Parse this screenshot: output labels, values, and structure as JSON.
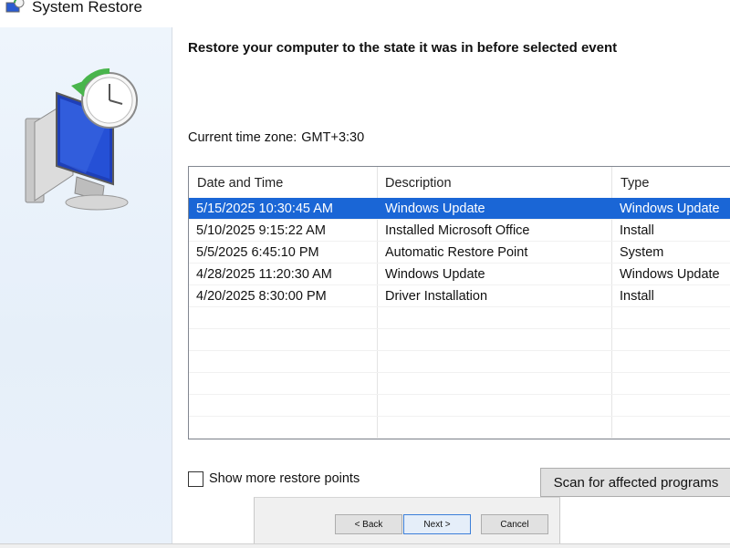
{
  "window": {
    "title": "System Restore",
    "icon": "system-restore-icon"
  },
  "sidebar": {
    "icon": "restore-clock-monitor-icon"
  },
  "main": {
    "heading": "Restore your computer to the state it was in before selected event",
    "timezone_label": "Current time zone:",
    "timezone_value": "GMT+3:30"
  },
  "table": {
    "columns": [
      "Date and Time",
      "Description",
      "Type"
    ],
    "rows": [
      {
        "date": "5/15/2025  10:30:45 AM",
        "description": "Windows Update",
        "type": "Windows Update",
        "selected": true
      },
      {
        "date": "5/10/2025  9:15:22 AM",
        "description": "Installed Microsoft Office",
        "type": "Install",
        "selected": false
      },
      {
        "date": "5/5/2025  6:45:10 PM",
        "description": "Automatic Restore Point",
        "type": "System",
        "selected": false
      },
      {
        "date": "4/28/2025  11:20:30 AM",
        "description": "Windows Update",
        "type": "Windows Update",
        "selected": false
      },
      {
        "date": "4/20/2025  8:30:00 PM",
        "description": "Driver Installation",
        "type": "Install",
        "selected": false
      }
    ]
  },
  "options": {
    "show_more_label": "Show more restore points",
    "show_more_checked": false
  },
  "buttons": {
    "scan": "Scan for affected programs",
    "back": "< Back",
    "next": "Next >",
    "cancel": "Cancel"
  },
  "colors": {
    "selection": "#1a66d6",
    "sidebar": "#e8f0fa"
  }
}
